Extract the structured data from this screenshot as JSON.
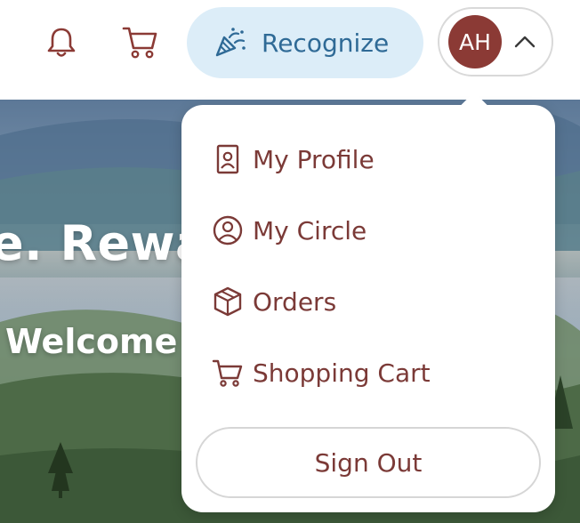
{
  "header": {
    "notifications_icon": "bell-icon",
    "cart_icon": "shopping-cart-icon",
    "recognize": {
      "label": "Recognize",
      "icon": "party-popper-icon"
    },
    "profile": {
      "initials": "AH",
      "toggle_icon": "chevron-up-icon"
    }
  },
  "hero": {
    "title_fragment": "e. Rewa",
    "subtitle_fragment": "Welcome"
  },
  "dropdown": {
    "items": [
      {
        "label": "My Profile",
        "icon": "id-badge-icon"
      },
      {
        "label": "My Circle",
        "icon": "user-circle-icon"
      },
      {
        "label": "Orders",
        "icon": "package-icon"
      },
      {
        "label": "Shopping Cart",
        "icon": "shopping-cart-icon"
      }
    ],
    "sign_out_label": "Sign Out"
  },
  "colors": {
    "brand_maroon": "#7b3a37",
    "avatar_bg": "#8b3a35",
    "recognize_bg": "#dcedf8",
    "recognize_text": "#2f6a96"
  }
}
